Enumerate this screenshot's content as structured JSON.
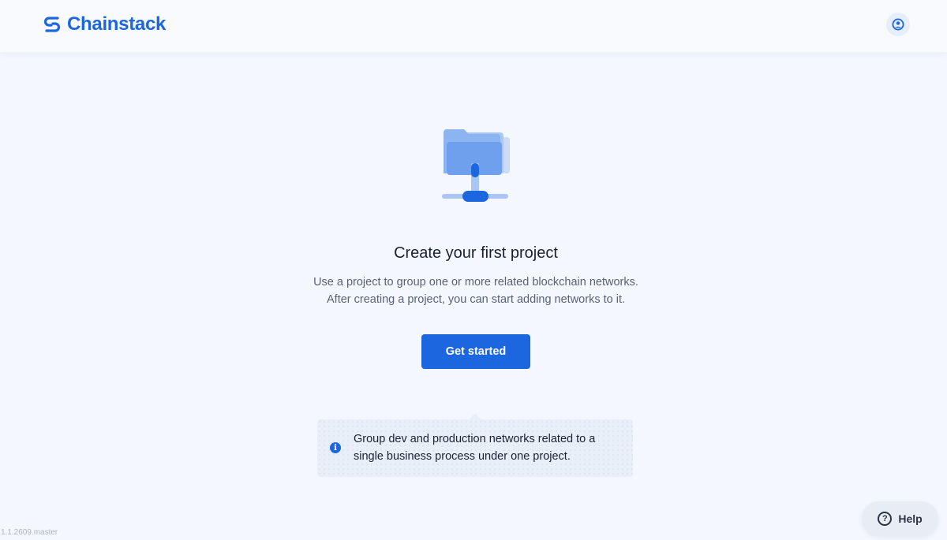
{
  "header": {
    "brand": "Chainstack",
    "brand_color": "#1c67e0",
    "user_icon": "user-circle-icon"
  },
  "empty_state": {
    "illustration": "folder-network-icon",
    "title": "Create your first project",
    "description_line1": "Use a project to group one or more related blockchain networks.",
    "description_line2": "After creating a project, you can start adding networks to it.",
    "cta_label": "Get started"
  },
  "tip": {
    "icon": "info-icon",
    "line1": "Group dev and production networks related to a",
    "line2": "single business process under one project."
  },
  "footer": {
    "version": "1.1.2609.master"
  },
  "help": {
    "icon": "question-circle-icon",
    "label": "Help"
  }
}
